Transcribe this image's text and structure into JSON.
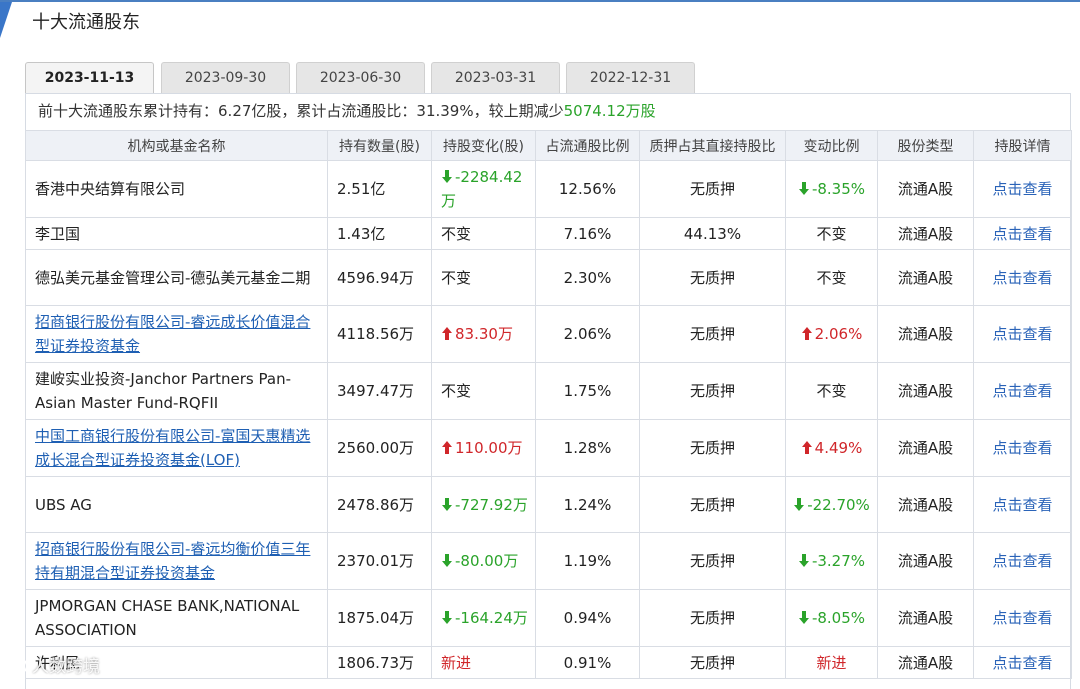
{
  "section_title": "十大流通股东",
  "tabs": [
    "2023-11-13",
    "2023-09-30",
    "2023-06-30",
    "2023-03-31",
    "2022-12-31"
  ],
  "active_tab": 0,
  "summary": {
    "prefix": "前十大流通股东累计持有：6.27亿股，累计占流通股比：31.39%，较上期减少",
    "amount": "5074.12万股"
  },
  "colors": {
    "up": "#d0262a",
    "down": "#2aa32a",
    "link": "#1e5fb3"
  },
  "columns": [
    "机构或基金名称",
    "持有数量(股)",
    "持股变化(股)",
    "占流通股比例",
    "质押占其直接持股比",
    "变动比例",
    "股份类型",
    "持股详情"
  ],
  "rows": [
    {
      "name": "香港中央结算有限公司",
      "link": false,
      "qty": "2.51亿",
      "change": "-2284.42万",
      "change_dir": "down",
      "ratio": "12.56%",
      "pledge": "无质押",
      "pct": "-8.35%",
      "pct_dir": "down",
      "type": "流通A股",
      "detail": "点击查看"
    },
    {
      "name": "李卫国",
      "link": false,
      "qty": "1.43亿",
      "change": "不变",
      "change_dir": "none",
      "ratio": "7.16%",
      "pledge": "44.13%",
      "pct": "不变",
      "pct_dir": "none",
      "type": "流通A股",
      "detail": "点击查看"
    },
    {
      "name": "德弘美元基金管理公司-德弘美元基金二期",
      "link": false,
      "qty": "4596.94万",
      "change": "不变",
      "change_dir": "none",
      "ratio": "2.30%",
      "pledge": "无质押",
      "pct": "不变",
      "pct_dir": "none",
      "type": "流通A股",
      "detail": "点击查看"
    },
    {
      "name": "招商银行股份有限公司-睿远成长价值混合型证券投资基金",
      "link": true,
      "qty": "4118.56万",
      "change": "83.30万",
      "change_dir": "up",
      "ratio": "2.06%",
      "pledge": "无质押",
      "pct": "2.06%",
      "pct_dir": "up",
      "type": "流通A股",
      "detail": "点击查看"
    },
    {
      "name": "建峖实业投资-Janchor Partners Pan-Asian Master Fund-RQFII",
      "link": false,
      "qty": "3497.47万",
      "change": "不变",
      "change_dir": "none",
      "ratio": "1.75%",
      "pledge": "无质押",
      "pct": "不变",
      "pct_dir": "none",
      "type": "流通A股",
      "detail": "点击查看"
    },
    {
      "name": "中国工商银行股份有限公司-富国天惠精选成长混合型证券投资基金(LOF)",
      "link": true,
      "qty": "2560.00万",
      "change": "110.00万",
      "change_dir": "up",
      "ratio": "1.28%",
      "pledge": "无质押",
      "pct": "4.49%",
      "pct_dir": "up",
      "type": "流通A股",
      "detail": "点击查看"
    },
    {
      "name": "UBS AG",
      "link": false,
      "qty": "2478.86万",
      "change": "-727.92万",
      "change_dir": "down",
      "ratio": "1.24%",
      "pledge": "无质押",
      "pct": "-22.70%",
      "pct_dir": "down",
      "type": "流通A股",
      "detail": "点击查看"
    },
    {
      "name": "招商银行股份有限公司-睿远均衡价值三年持有期混合型证券投资基金",
      "link": true,
      "qty": "2370.01万",
      "change": "-80.00万",
      "change_dir": "down",
      "ratio": "1.19%",
      "pledge": "无质押",
      "pct": "-3.27%",
      "pct_dir": "down",
      "type": "流通A股",
      "detail": "点击查看"
    },
    {
      "name": "JPMORGAN CHASE BANK,NATIONAL ASSOCIATION",
      "link": false,
      "qty": "1875.04万",
      "change": "-164.24万",
      "change_dir": "down",
      "ratio": "0.94%",
      "pledge": "无质押",
      "pct": "-8.05%",
      "pct_dir": "down",
      "type": "流通A股",
      "detail": "点击查看"
    },
    {
      "name": "许利民",
      "link": false,
      "qty": "1806.73万",
      "change": "新进",
      "change_dir": "new",
      "ratio": "0.91%",
      "pledge": "无质押",
      "pct": "新进",
      "pct_dir": "new",
      "type": "流通A股",
      "detail": "点击查看"
    }
  ],
  "watermark": "人数跨境"
}
